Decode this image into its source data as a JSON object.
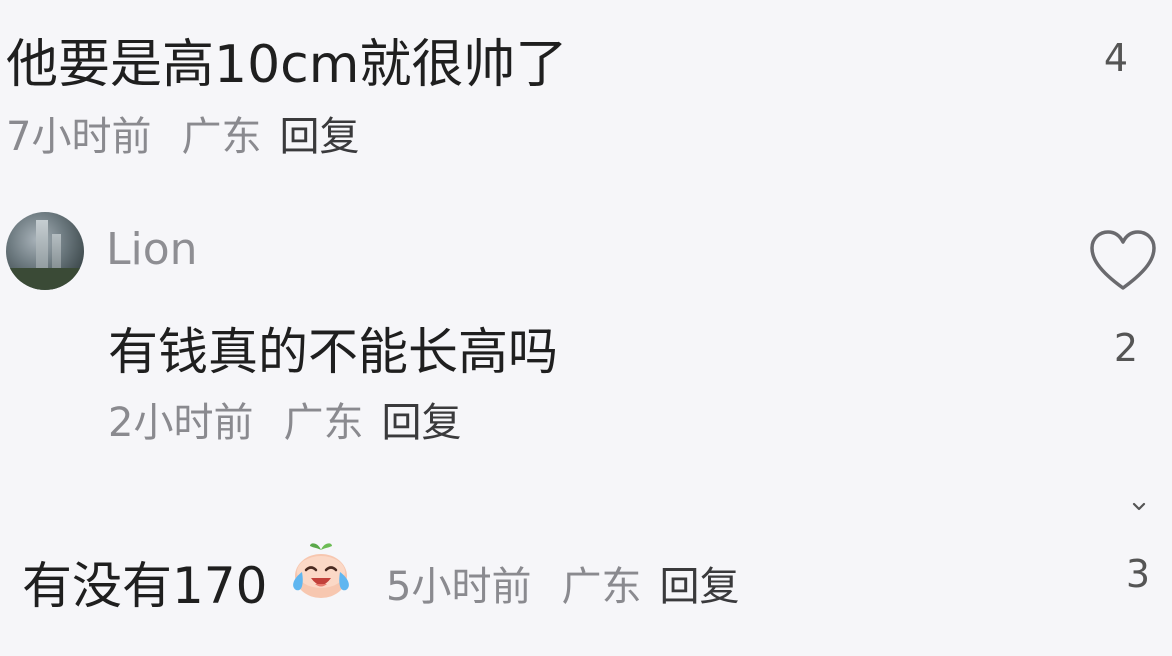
{
  "comments": [
    {
      "text": "他要是高10cm就很帅了",
      "time": "7小时前",
      "location": "广东",
      "reply_label": "回复",
      "count": "4"
    },
    {
      "user": "Lion",
      "avatar_icon": "avatar-image",
      "text": "有钱真的不能长高吗",
      "time": "2小时前",
      "location": "广东",
      "reply_label": "回复",
      "like_icon": "heart-icon",
      "count": "2"
    },
    {
      "text": "有没有170",
      "emoji_icon": "crying-laughing-emoji",
      "time": "5小时前",
      "location": "广东",
      "reply_label": "回复",
      "count": "3"
    }
  ],
  "expand_icon": "chevron-down-icon",
  "colors": {
    "background": "#f6f6f9",
    "text_primary": "#1f1f1f",
    "text_meta": "#8a8a8f"
  }
}
